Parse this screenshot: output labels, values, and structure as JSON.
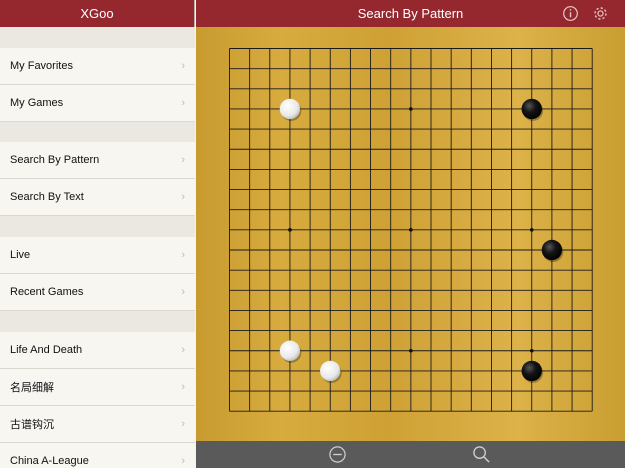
{
  "sidebar": {
    "title": "XGoo",
    "groups": [
      [
        "My Favorites",
        "My Games"
      ],
      [
        "Search By Pattern",
        "Search By Text"
      ],
      [
        "Live",
        "Recent Games"
      ],
      [
        "Life And Death",
        "名局细解",
        "古谱钩沉",
        "China A-League"
      ]
    ]
  },
  "main": {
    "title": "Search By Pattern",
    "icons": {
      "info": "info-icon",
      "settings": "gear-icon",
      "zoom_out": "zoom-out-icon",
      "search": "search-icon"
    }
  },
  "board": {
    "size": 19,
    "star_points": [
      [
        3,
        3
      ],
      [
        9,
        3
      ],
      [
        15,
        3
      ],
      [
        3,
        9
      ],
      [
        9,
        9
      ],
      [
        15,
        9
      ],
      [
        3,
        15
      ],
      [
        9,
        15
      ],
      [
        15,
        15
      ]
    ],
    "stones": [
      {
        "col": 3,
        "row": 3,
        "color": "white"
      },
      {
        "col": 15,
        "row": 3,
        "color": "black"
      },
      {
        "col": 16,
        "row": 10,
        "color": "black"
      },
      {
        "col": 3,
        "row": 15,
        "color": "white"
      },
      {
        "col": 5,
        "row": 16,
        "color": "white"
      },
      {
        "col": 15,
        "row": 16,
        "color": "black"
      }
    ]
  },
  "colors": {
    "header": "#95282f",
    "bottom_bar": "#5a5a5a"
  }
}
